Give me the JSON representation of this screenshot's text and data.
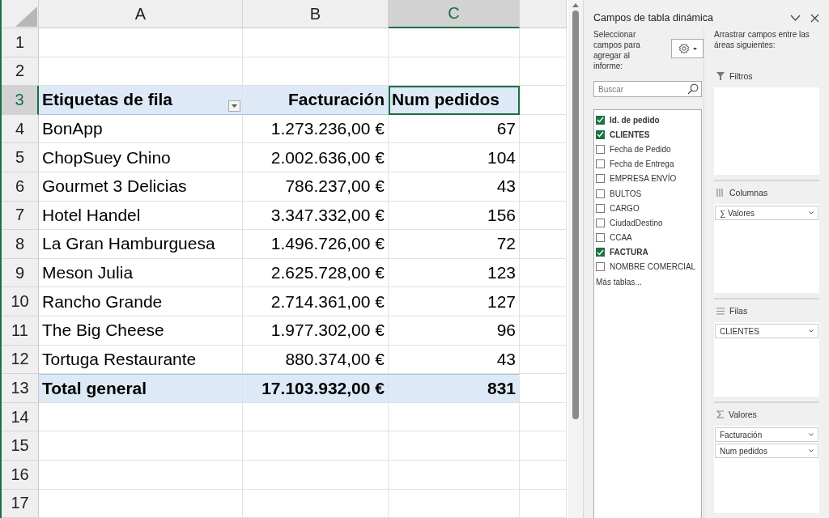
{
  "sheet": {
    "columns": [
      {
        "label": "A",
        "selected": false
      },
      {
        "label": "B",
        "selected": false
      },
      {
        "label": "C",
        "selected": true
      }
    ],
    "rows": [
      {
        "number": "1",
        "selected": false,
        "kind": "blank"
      },
      {
        "number": "2",
        "selected": false,
        "kind": "blank"
      },
      {
        "number": "3",
        "selected": true,
        "kind": "header",
        "filter_button": true,
        "cells": [
          "Etiquetas de fila",
          "Facturación",
          "Num pedidos"
        ]
      },
      {
        "number": "4",
        "selected": false,
        "kind": "item",
        "cells": [
          "BonApp",
          "1.273.236,00 €",
          "67"
        ]
      },
      {
        "number": "5",
        "selected": false,
        "kind": "item",
        "cells": [
          "ChopSuey Chino",
          "2.002.636,00 €",
          "104"
        ]
      },
      {
        "number": "6",
        "selected": false,
        "kind": "item",
        "cells": [
          "Gourmet 3 Delicias",
          "786.237,00 €",
          "43"
        ]
      },
      {
        "number": "7",
        "selected": false,
        "kind": "item",
        "cells": [
          "Hotel Handel",
          "3.347.332,00 €",
          "156"
        ]
      },
      {
        "number": "8",
        "selected": false,
        "kind": "item",
        "cells": [
          "La Gran Hamburguesa",
          "1.496.726,00 €",
          "72"
        ]
      },
      {
        "number": "9",
        "selected": false,
        "kind": "item",
        "cells": [
          "Meson Julia",
          "2.625.728,00 €",
          "123"
        ]
      },
      {
        "number": "10",
        "selected": false,
        "kind": "item",
        "cells": [
          "Rancho Grande",
          "2.714.361,00 €",
          "127"
        ]
      },
      {
        "number": "11",
        "selected": false,
        "kind": "item",
        "cells": [
          "The Big Cheese",
          "1.977.302,00 €",
          "96"
        ]
      },
      {
        "number": "12",
        "selected": false,
        "kind": "item",
        "cells": [
          "Tortuga Restaurante",
          "880.374,00 €",
          "43"
        ]
      },
      {
        "number": "13",
        "selected": false,
        "kind": "total",
        "cells": [
          "Total general",
          "17.103.932,00 €",
          "831"
        ]
      },
      {
        "number": "14",
        "selected": false,
        "kind": "blank"
      },
      {
        "number": "15",
        "selected": false,
        "kind": "blank"
      },
      {
        "number": "16",
        "selected": false,
        "kind": "blank"
      },
      {
        "number": "17",
        "selected": false,
        "kind": "blank"
      }
    ]
  },
  "pivot_panel": {
    "title": "Campos de tabla dinámica",
    "fields_caption": "Seleccionar campos para agregar al informe:",
    "areas_caption": "Arrastrar campos entre las áreas siguientes:",
    "search": {
      "placeholder": "Buscar"
    },
    "fields": [
      {
        "label": "Id. de pedido",
        "checked": true
      },
      {
        "label": "CLIENTES",
        "checked": true
      },
      {
        "label": "Fecha de Pedido",
        "checked": false
      },
      {
        "label": "Fecha de Entrega",
        "checked": false
      },
      {
        "label": "EMPRESA ENVÍO",
        "checked": false
      },
      {
        "label": "BULTOS",
        "checked": false
      },
      {
        "label": "CARGO",
        "checked": false
      },
      {
        "label": "CiudadDestino",
        "checked": false
      },
      {
        "label": "CCAA",
        "checked": false
      },
      {
        "label": "FACTURA",
        "checked": true
      },
      {
        "label": "NOMBRE COMERCIAL",
        "checked": false
      }
    ],
    "more_tables": "Más tablas...",
    "areas": [
      {
        "kind": "filters",
        "title": "Filtros"
      },
      {
        "kind": "columns",
        "title": "Columnas",
        "items": [
          "∑ Valores"
        ]
      },
      {
        "kind": "rows",
        "title": "Filas",
        "items": [
          "CLIENTES"
        ]
      },
      {
        "kind": "values",
        "title": "Valores",
        "items": [
          "Facturación",
          "Num pedidos"
        ]
      }
    ]
  }
}
